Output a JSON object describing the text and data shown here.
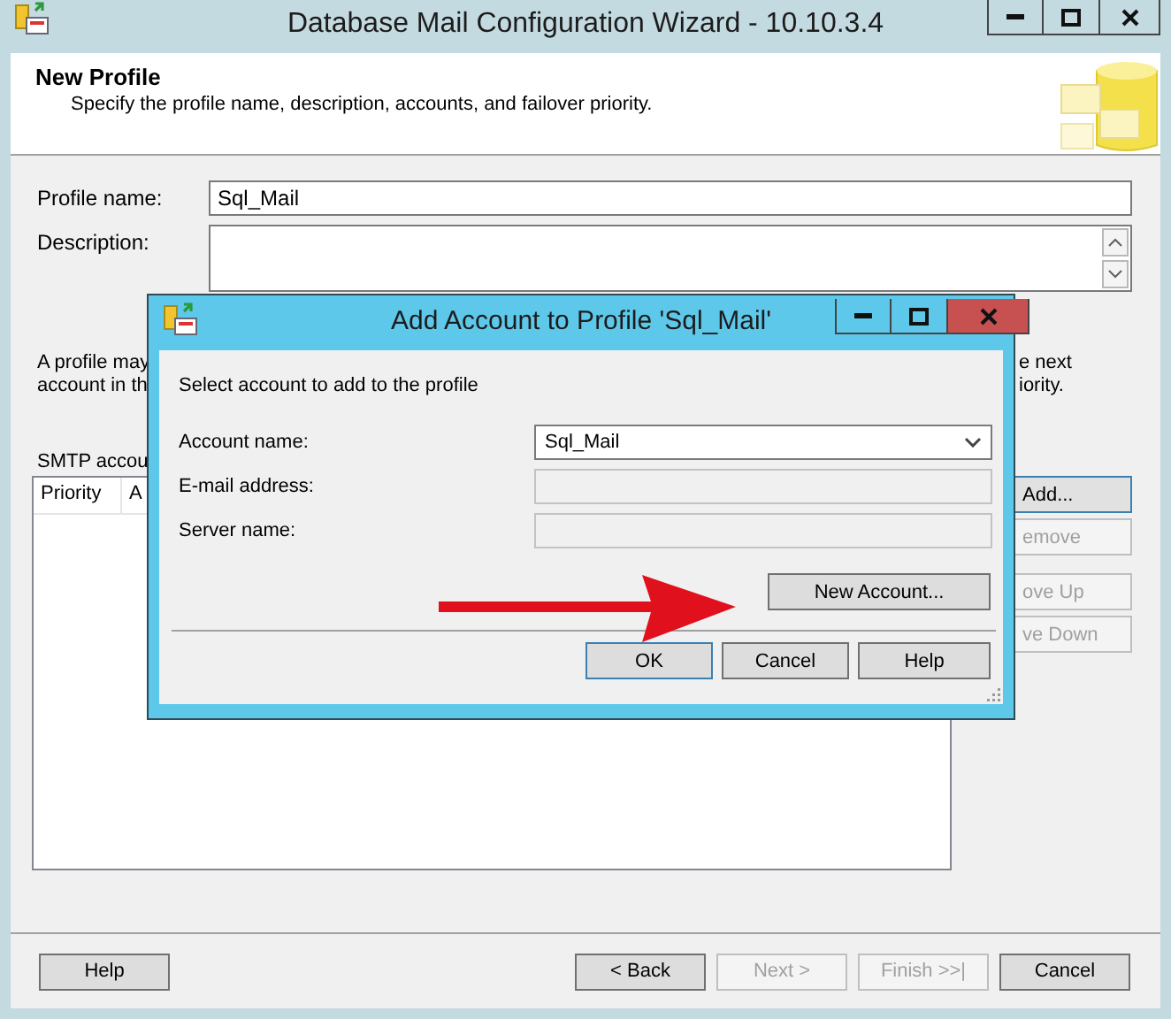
{
  "window": {
    "title": "Database Mail Configuration Wizard - 10.10.3.4"
  },
  "header": {
    "title": "New Profile",
    "subtitle": "Specify the profile name, description, accounts, and failover priority."
  },
  "fields": [
    {
      "label": "Profile name:",
      "kind": "text",
      "value": "Sql_Mail"
    },
    {
      "label": "Description:",
      "kind": "multiline"
    }
  ],
  "info_text": {
    "left": [
      "A profile may",
      "account in th"
    ],
    "right": [
      "e next",
      "iority."
    ]
  },
  "accounts": {
    "label": "SMTP accou",
    "columns": [
      "Priority",
      "A"
    ]
  },
  "side_buttons": [
    {
      "label": "Add...",
      "disabled": false,
      "focused": true
    },
    {
      "label": "emove",
      "disabled": true,
      "focused": false
    },
    {
      "label": "ove Up",
      "disabled": true,
      "focused": false
    },
    {
      "label": "ve Down",
      "disabled": true,
      "focused": false
    }
  ],
  "footer_buttons": [
    {
      "label": "Help",
      "disabled": false
    },
    {
      "label": "< Back",
      "disabled": false
    },
    {
      "label": "Next >",
      "disabled": true
    },
    {
      "label": "Finish >>|",
      "disabled": true
    },
    {
      "label": "Cancel",
      "disabled": false
    }
  ],
  "dialog": {
    "title": "Add Account to Profile 'Sql_Mail'",
    "prompt": "Select account to add to the profile",
    "fields": [
      {
        "label": "Account name:",
        "kind": "dropdown",
        "value": "Sql_Mail",
        "disabled": false
      },
      {
        "label": "E-mail address:",
        "kind": "text",
        "disabled": true
      },
      {
        "label": "Server name:",
        "kind": "text",
        "disabled": true
      }
    ],
    "new_account_button": "New Account...",
    "buttons": [
      {
        "label": "OK",
        "default": true
      },
      {
        "label": "Cancel",
        "default": false
      },
      {
        "label": "Help",
        "default": false
      }
    ]
  }
}
